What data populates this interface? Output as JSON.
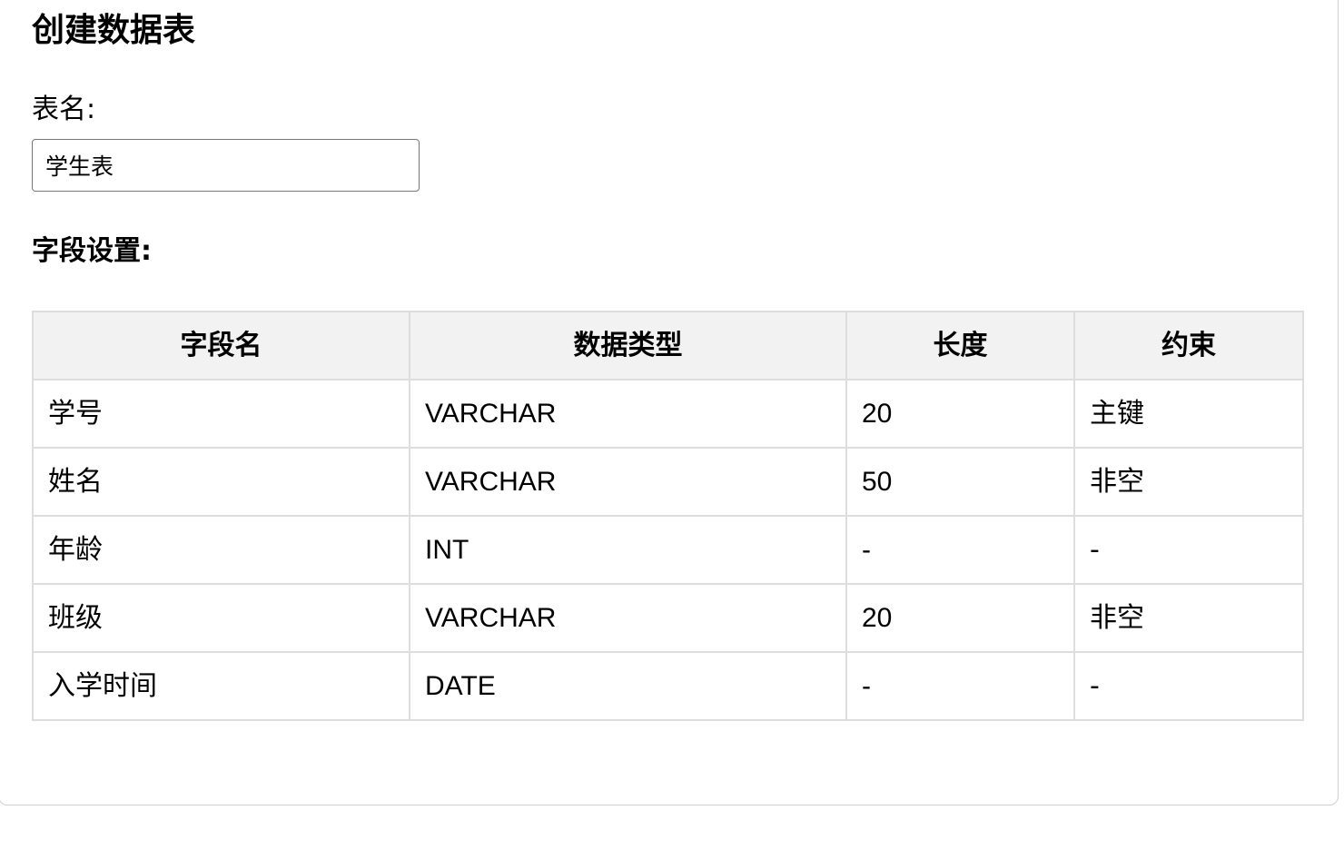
{
  "page": {
    "title": "创建数据表"
  },
  "table_name": {
    "label": "表名:",
    "value": "学生表"
  },
  "fields_section": {
    "title": "字段设置:"
  },
  "fields_table": {
    "headers": [
      "字段名",
      "数据类型",
      "长度",
      "约束"
    ],
    "rows": [
      [
        "学号",
        "VARCHAR",
        "20",
        "主键"
      ],
      [
        "姓名",
        "VARCHAR",
        "50",
        "非空"
      ],
      [
        "年龄",
        "INT",
        "-",
        "-"
      ],
      [
        "班级",
        "VARCHAR",
        "20",
        "非空"
      ],
      [
        "入学时间",
        "DATE",
        "-",
        "-"
      ]
    ]
  },
  "colors": {
    "header_bg": "#f2f2f2",
    "border": "#dddddd",
    "text": "#000000"
  }
}
